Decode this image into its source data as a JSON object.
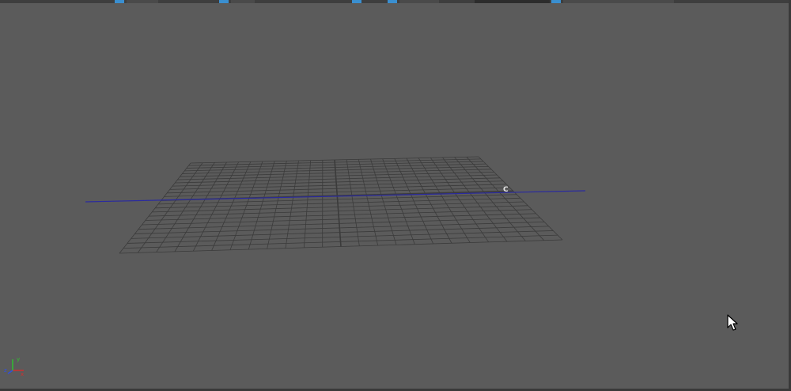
{
  "viewport": {
    "background": "#5b5b5b",
    "grid_color": "#3b3b3b",
    "grid_divisions": 24,
    "horizon_line_color": "#2a2aa0",
    "camera_label": "C"
  },
  "axis_gizmo": {
    "x_label": "x",
    "y_label": "y",
    "z_label": "z",
    "x_color": "#d03030",
    "y_color": "#30c030",
    "z_color": "#3050e0"
  },
  "cursor": {
    "icon": "arrow-cursor-icon"
  },
  "toolbar": {
    "accent": "#3a8fd0"
  }
}
